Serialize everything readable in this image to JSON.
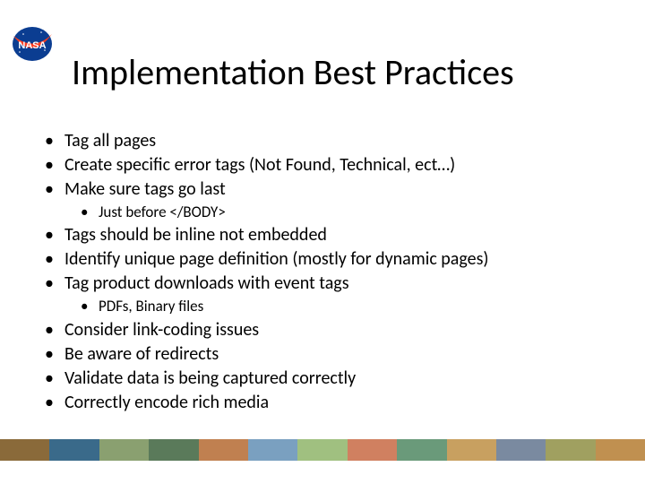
{
  "title": "Implementation Best Practices",
  "bullets": {
    "b0": "Tag all pages",
    "b1": "Create specific error tags (Not Found, Technical, ect…)",
    "b2": "Make sure tags go last",
    "b2s0": "Just before </BODY>",
    "b3": "Tags should be inline not embedded",
    "b4": "Identify unique page definition (mostly for dynamic pages)",
    "b5": "Tag product downloads with event tags",
    "b5s0": "PDFs, Binary files",
    "b6": "Consider link-coding issues",
    "b7": "Be aware of redirects",
    "b8": "Validate data is being captured correctly",
    "b9": "Correctly encode rich media"
  },
  "logo_name": "NASA",
  "footer_colors": [
    "#8a6a3a",
    "#3a6a8a",
    "#8aa070",
    "#5a7a5a",
    "#c08050",
    "#7aa0c0",
    "#a0c080",
    "#d08060",
    "#6a9a7a",
    "#c8a060",
    "#7a8aa0",
    "#a0a060",
    "#c09050"
  ]
}
